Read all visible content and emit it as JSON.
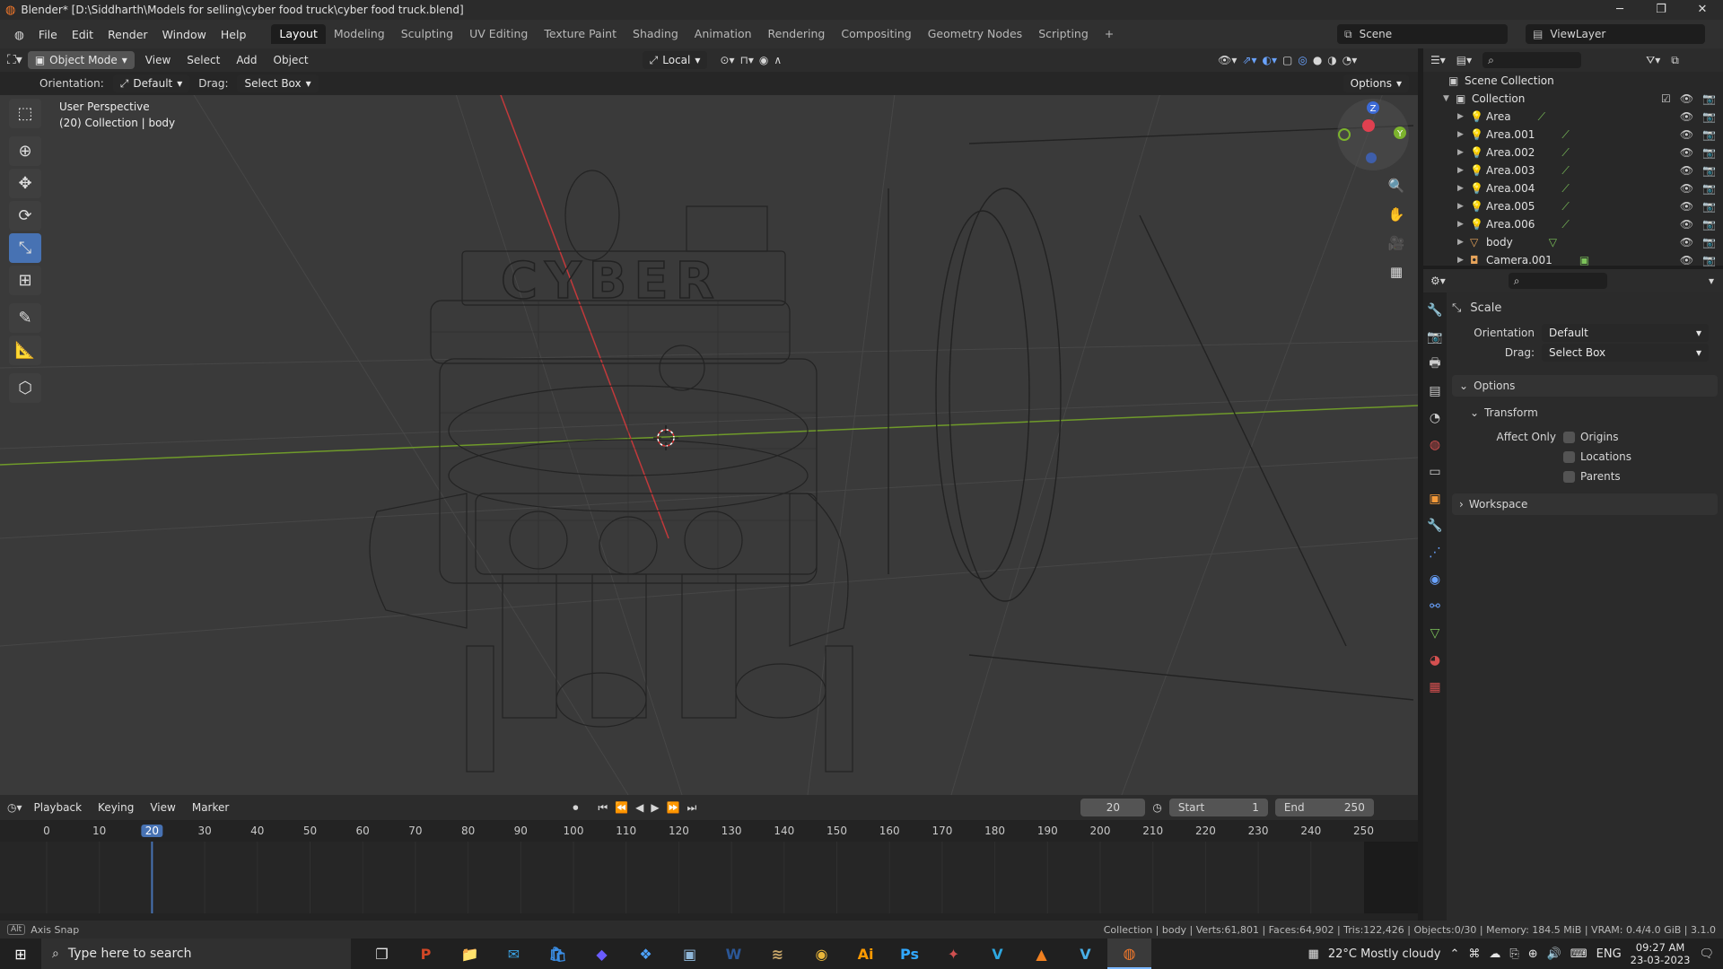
{
  "window": {
    "title": "Blender* [D:\\Siddharth\\Models for selling\\cyber food truck\\cyber food truck.blend]",
    "minimize": "─",
    "maximize": "❐",
    "close": "✕"
  },
  "menubar": {
    "items": [
      "File",
      "Edit",
      "Render",
      "Window",
      "Help"
    ],
    "workspaces": [
      "Layout",
      "Modeling",
      "Sculpting",
      "UV Editing",
      "Texture Paint",
      "Shading",
      "Animation",
      "Rendering",
      "Compositing",
      "Geometry Nodes",
      "Scripting",
      "+"
    ],
    "active_workspace": "Layout",
    "scene": "Scene",
    "view_layer": "ViewLayer"
  },
  "viewport_header": {
    "mode": "Object Mode",
    "menus": [
      "View",
      "Select",
      "Add",
      "Object"
    ],
    "transform_orientation": "Local"
  },
  "tool_header": {
    "orientation_label": "Orientation:",
    "orientation_value": "Default",
    "drag_label": "Drag:",
    "drag_value": "Select Box",
    "options": "Options"
  },
  "viewport": {
    "perspective": "User Perspective",
    "collection_info": "(20) Collection | body",
    "truck_sign": "CYBER"
  },
  "tools": [
    {
      "name": "select-box-tool",
      "glyph": "⬚",
      "active": false
    },
    {
      "name": "cursor-tool",
      "glyph": "⊕",
      "active": false
    },
    {
      "name": "move-tool",
      "glyph": "✥",
      "active": false
    },
    {
      "name": "rotate-tool",
      "glyph": "⟳",
      "active": false
    },
    {
      "name": "scale-tool",
      "glyph": "⤡",
      "active": true
    },
    {
      "name": "transform-tool",
      "glyph": "⊞",
      "active": false
    },
    {
      "name": "annotate-tool",
      "glyph": "✎",
      "active": false
    },
    {
      "name": "measure-tool",
      "glyph": "📐",
      "active": false
    },
    {
      "name": "add-cube-tool",
      "glyph": "⬡",
      "active": false
    }
  ],
  "nav_buttons": [
    "🔍",
    "✋",
    "🎥",
    "▦"
  ],
  "gizmo": {
    "z": "Z",
    "y": "Y"
  },
  "outliner": {
    "root": "Scene Collection",
    "collection": "Collection",
    "items": [
      {
        "name": "Area"
      },
      {
        "name": "Area.001"
      },
      {
        "name": "Area.002"
      },
      {
        "name": "Area.003"
      },
      {
        "name": "Area.004"
      },
      {
        "name": "Area.005"
      },
      {
        "name": "Area.006"
      },
      {
        "name": "body"
      },
      {
        "name": "Camera.001"
      }
    ]
  },
  "properties": {
    "tool_name": "Scale",
    "orientation_label": "Orientation",
    "orientation_value": "Default",
    "drag_label": "Drag:",
    "drag_value": "Select Box",
    "options_panel": "Options",
    "transform_panel": "Transform",
    "affect_only_label": "Affect Only",
    "checkboxes": [
      "Origins",
      "Locations",
      "Parents"
    ],
    "workspace_panel": "Workspace"
  },
  "timeline": {
    "menus": [
      "Playback",
      "Keying",
      "View",
      "Marker"
    ],
    "current_frame": "20",
    "start_label": "Start",
    "start": "1",
    "end_label": "End",
    "end": "250",
    "ruler": [
      "0",
      "10",
      "20",
      "30",
      "40",
      "50",
      "60",
      "70",
      "80",
      "90",
      "100",
      "110",
      "120",
      "130",
      "140",
      "150",
      "160",
      "170",
      "180",
      "190",
      "200",
      "210",
      "220",
      "230",
      "240",
      "250"
    ]
  },
  "statusbar": {
    "left": "Axis Snap",
    "right": "Collection | body | Verts:61,801 | Faces:64,902 | Tris:122,426 | Objects:0/30 | Memory: 184.5 MiB | VRAM: 0.4/4.0 GiB | 3.1.0"
  },
  "taskbar": {
    "search_placeholder": "Type here to search",
    "apps": [
      {
        "name": "task-view-icon",
        "glyph": "❐",
        "color": "#e5e5e5"
      },
      {
        "name": "powerpoint-icon",
        "glyph": "P",
        "color": "#d24726"
      },
      {
        "name": "file-explorer-icon",
        "glyph": "📁",
        "color": "#f3c13a"
      },
      {
        "name": "mail-icon",
        "glyph": "✉",
        "color": "#3aa0e0"
      },
      {
        "name": "store-icon",
        "glyph": "🛍",
        "color": "#3a8ee6"
      },
      {
        "name": "copilot-icon",
        "glyph": "◆",
        "color": "#6a5cff"
      },
      {
        "name": "app-icon-1",
        "glyph": "❖",
        "color": "#4da3ff"
      },
      {
        "name": "app-icon-2",
        "glyph": "▣",
        "color": "#8fb7d9"
      },
      {
        "name": "word-icon",
        "glyph": "W",
        "color": "#2b5797"
      },
      {
        "name": "app-icon-3",
        "glyph": "≋",
        "color": "#caa86a"
      },
      {
        "name": "chrome-icon",
        "glyph": "◉",
        "color": "#e8b53a"
      },
      {
        "name": "illustrator-icon",
        "glyph": "Ai",
        "color": "#ff9a00"
      },
      {
        "name": "photoshop-icon",
        "glyph": "Ps",
        "color": "#31a8ff"
      },
      {
        "name": "app-icon-4",
        "glyph": "✦",
        "color": "#d05050"
      },
      {
        "name": "vscode-icon",
        "glyph": "V",
        "color": "#2ea7e0"
      },
      {
        "name": "vlc-icon",
        "glyph": "▲",
        "color": "#f08020"
      },
      {
        "name": "app-icon-5",
        "glyph": "V",
        "color": "#49b0e8"
      },
      {
        "name": "blender-icon",
        "glyph": "◍",
        "color": "#f5792a",
        "active": true
      }
    ],
    "weather": "22°C  Mostly cloudy",
    "language": "ENG",
    "time": "09:27 AM",
    "date": "23-03-2023"
  }
}
